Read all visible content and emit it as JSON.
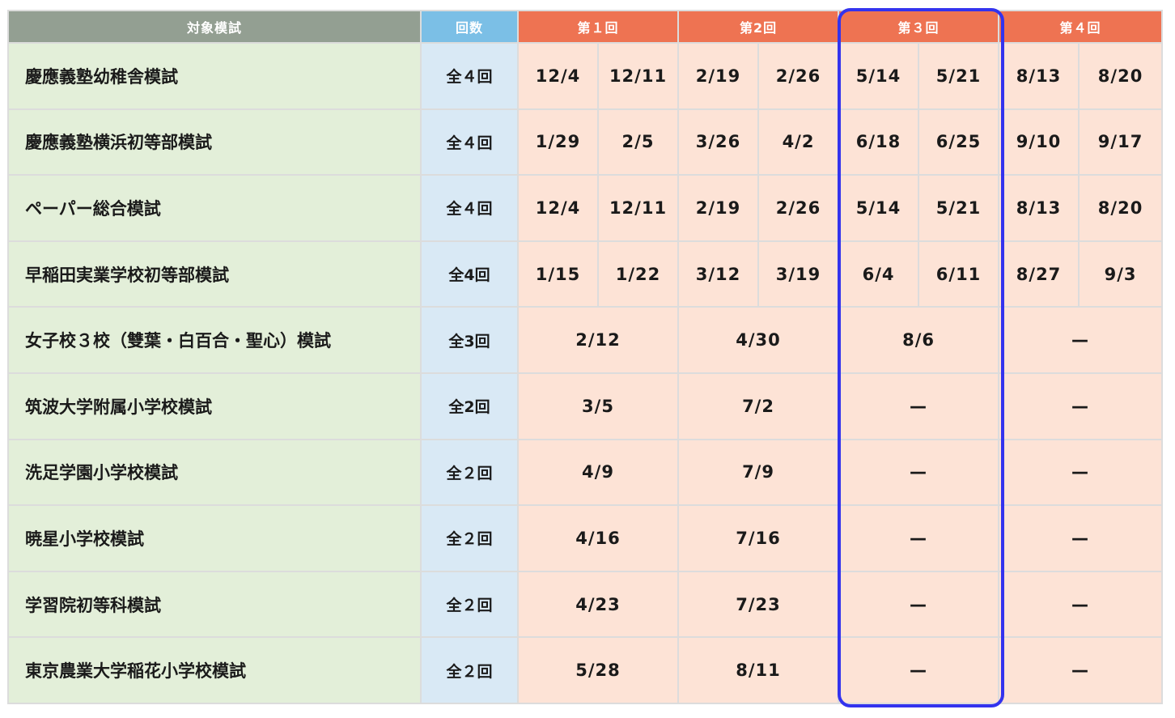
{
  "header": {
    "name": "対象模試",
    "count": "回数",
    "rounds": [
      "第１回",
      "第2回",
      "第３回",
      "第４回"
    ]
  },
  "highlight": {
    "round_index": 3,
    "color": "#3333ee"
  },
  "colors": {
    "name_header": "#939f92",
    "count_header": "#7bbfe6",
    "round_header": "#ee7352",
    "name_cell": "#e3efd9",
    "count_cell": "#d9e9f5",
    "date_cell": "#fde3d6"
  },
  "rows": [
    {
      "name": "慶應義塾幼稚舎模試",
      "count": "全４回",
      "cells": [
        "12/4",
        "12/11",
        "2/19",
        "2/26",
        "5/14",
        "5/21",
        "8/13",
        "8/20"
      ]
    },
    {
      "name": "慶應義塾横浜初等部模試",
      "count": "全４回",
      "cells": [
        "1/29",
        "2/5",
        "3/26",
        "4/2",
        "6/18",
        "6/25",
        "9/10",
        "9/17"
      ]
    },
    {
      "name": "ペーパー総合模試",
      "count": "全４回",
      "cells": [
        "12/4",
        "12/11",
        "2/19",
        "2/26",
        "5/14",
        "5/21",
        "8/13",
        "8/20"
      ]
    },
    {
      "name": "早稲田実業学校初等部模試",
      "count": "全4回",
      "cells": [
        "1/15",
        "1/22",
        "3/12",
        "3/19",
        "6/4",
        "6/11",
        "8/27",
        "9/3"
      ]
    },
    {
      "name": "女子校３校（雙葉・白百合・聖心）模試",
      "count": "全3回",
      "cells": [
        "2/12",
        "4/30",
        "8/6",
        "—"
      ]
    },
    {
      "name": "筑波大学附属小学校模試",
      "count": "全2回",
      "cells": [
        "3/5",
        "7/2",
        "—",
        "—"
      ]
    },
    {
      "name": "洗足学園小学校模試",
      "count": "全２回",
      "cells": [
        "4/9",
        "7/9",
        "—",
        "—"
      ]
    },
    {
      "name": "暁星小学校模試",
      "count": "全２回",
      "cells": [
        "4/16",
        "7/16",
        "—",
        "—"
      ]
    },
    {
      "name": "学習院初等科模試",
      "count": "全２回",
      "cells": [
        "4/23",
        "7/23",
        "—",
        "—"
      ]
    },
    {
      "name": "東京農業大学稲花小学校模試",
      "count": "全２回",
      "cells": [
        "5/28",
        "8/11",
        "—",
        "—"
      ]
    }
  ]
}
